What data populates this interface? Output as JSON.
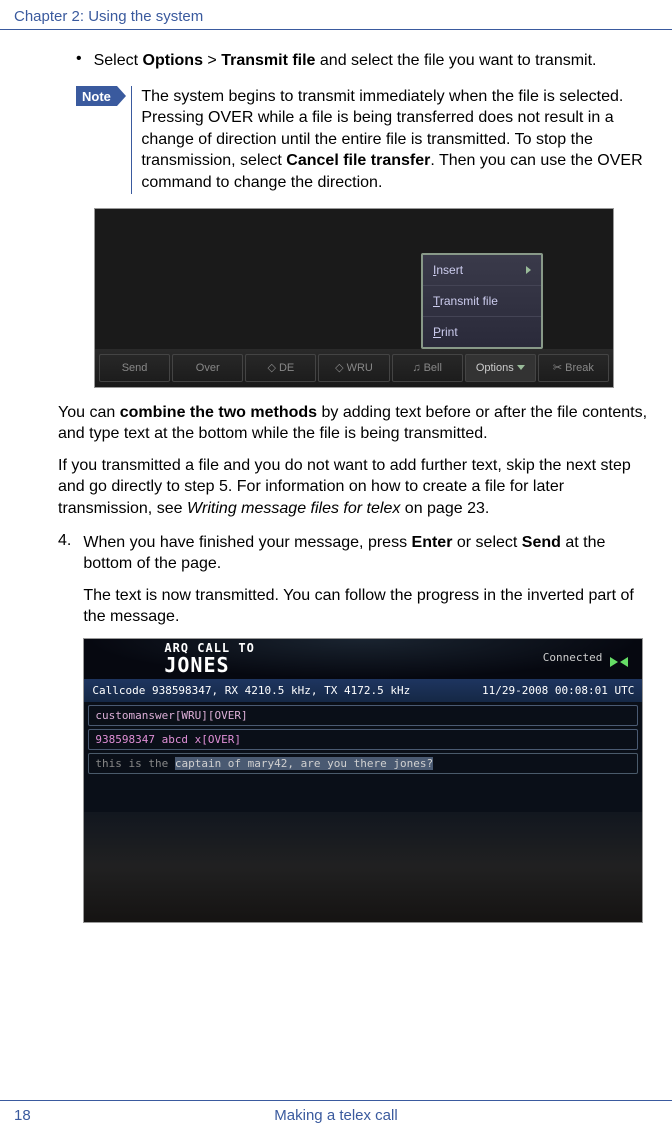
{
  "header": "Chapter 2:  Using the system",
  "bullet": {
    "marker": "•",
    "pre": "Select ",
    "b1": "Options",
    "mid1": " > ",
    "b2": "Transmit file",
    "post": " and select the file you want to transmit."
  },
  "note": {
    "tag": "Note",
    "text_pre": "The system begins to transmit immediately when the file is selected. Pressing OVER while a file is being transferred does not result in a change of direction until the entire file is transmitted. To stop the transmission, select ",
    "bold": "Cancel file transfer",
    "text_post": ". Then you can use the OVER command to change the direction."
  },
  "ss1": {
    "menu": {
      "insert": "Insert",
      "transmit": "Transmit file",
      "print": "Print"
    },
    "bar": {
      "send": "Send",
      "over": "Over",
      "de": "DE",
      "wru": "WRU",
      "bell": "Bell",
      "options": "Options",
      "break": "Break"
    }
  },
  "para1": {
    "pre": "You can ",
    "bold": "combine the two methods",
    "post": " by adding text before or after the file contents, and type text at the bottom while the file is being transmitted."
  },
  "para2": {
    "pre": "If you transmitted a file and you do not want to add further text, skip the next step and go directly to step 5. For information on how to create a file for later transmission, see ",
    "ital": "Writing message files for telex",
    "post": " on page 23."
  },
  "step4": {
    "num": "4.",
    "pre": "When you have finished your message, press ",
    "b1": "Enter",
    "mid": " or select ",
    "b2": "Send",
    "post": " at the bottom of the page.",
    "para": "The text is now transmitted. You can follow the progress in the inverted part of the message."
  },
  "ss2": {
    "title1": "ARQ  CALL  TO",
    "title2": "JONES",
    "connected": "Connected",
    "info_left": "Callcode 938598347, RX 4210.5 kHz, TX 4172.5 kHz",
    "info_right": "11/29-2008 00:08:01 UTC",
    "line1": "customanswer[WRU][OVER]",
    "line2": "938598347 abcd x[OVER]",
    "line3_pre": "this is the ",
    "line3_hl": "captain of mary42, are you there jones?"
  },
  "footer": {
    "page": "18",
    "title": "Making a telex call"
  }
}
